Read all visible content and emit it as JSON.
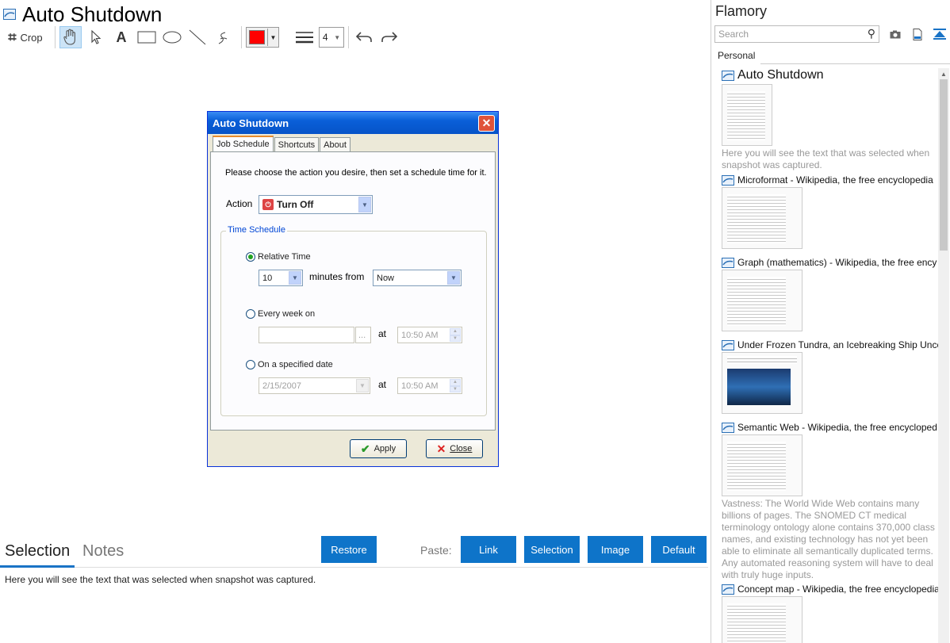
{
  "app": {
    "title": "Auto Shutdown"
  },
  "toolbar": {
    "crop_label": "Crop",
    "text_tool": "A",
    "line_width": "4",
    "color": "#ff0000"
  },
  "dialog": {
    "title": "Auto Shutdown",
    "tabs": [
      "Job Schedule",
      "Shortcuts",
      "About"
    ],
    "instruction": "Please choose the action you desire, then set a schedule time for it.",
    "action_label": "Action",
    "action_value": "Turn Off",
    "group_label": "Time Schedule",
    "relative_time_label": "Relative Time",
    "minutes_value": "10",
    "minutes_from_label": "minutes from",
    "from_value": "Now",
    "every_week_label": "Every week on",
    "ellipsis": "...",
    "at_label": "at",
    "time_value_1": "10:50 AM",
    "specified_date_label": "On a specified date",
    "date_value": "2/15/2007",
    "time_value_2": "10:50 AM",
    "apply_label": "Apply",
    "close_label": "Close"
  },
  "bottom": {
    "tab_selection": "Selection",
    "tab_notes": "Notes",
    "restore_label": "Restore",
    "paste_label": "Paste:",
    "paste_link": "Link",
    "paste_selection": "Selection",
    "paste_image": "Image",
    "paste_default": "Default",
    "selection_text": "Here you will see the text that was selected when snapshot was captured."
  },
  "sidebar": {
    "title": "Flamory",
    "search_placeholder": "Search",
    "tab": "Personal",
    "items": [
      {
        "title": "Auto Shutdown",
        "desc": "Here you will see the text that was selected when snapshot was captured."
      },
      {
        "title": "Microformat - Wikipedia, the free encyclopedia",
        "desc": ""
      },
      {
        "title": "Graph (mathematics) - Wikipedia, the free ency",
        "desc": ""
      },
      {
        "title": "Under Frozen Tundra, an Icebreaking Ship Unco",
        "desc": ""
      },
      {
        "title": "Semantic Web - Wikipedia, the free encycloped",
        "desc": "Vastness: The World Wide Web contains many billions of pages. The SNOMED CT medical terminology ontology alone contains 370,000 class names, and existing technology has not yet been able to eliminate all semantically duplicated terms. Any automated reasoning system will have to deal with truly huge inputs."
      },
      {
        "title": "Concept map - Wikipedia, the free encyclopedia",
        "desc": ""
      }
    ]
  },
  "colors": {
    "accent": "#0e74c9",
    "selected_tool": "#cce4f7"
  }
}
